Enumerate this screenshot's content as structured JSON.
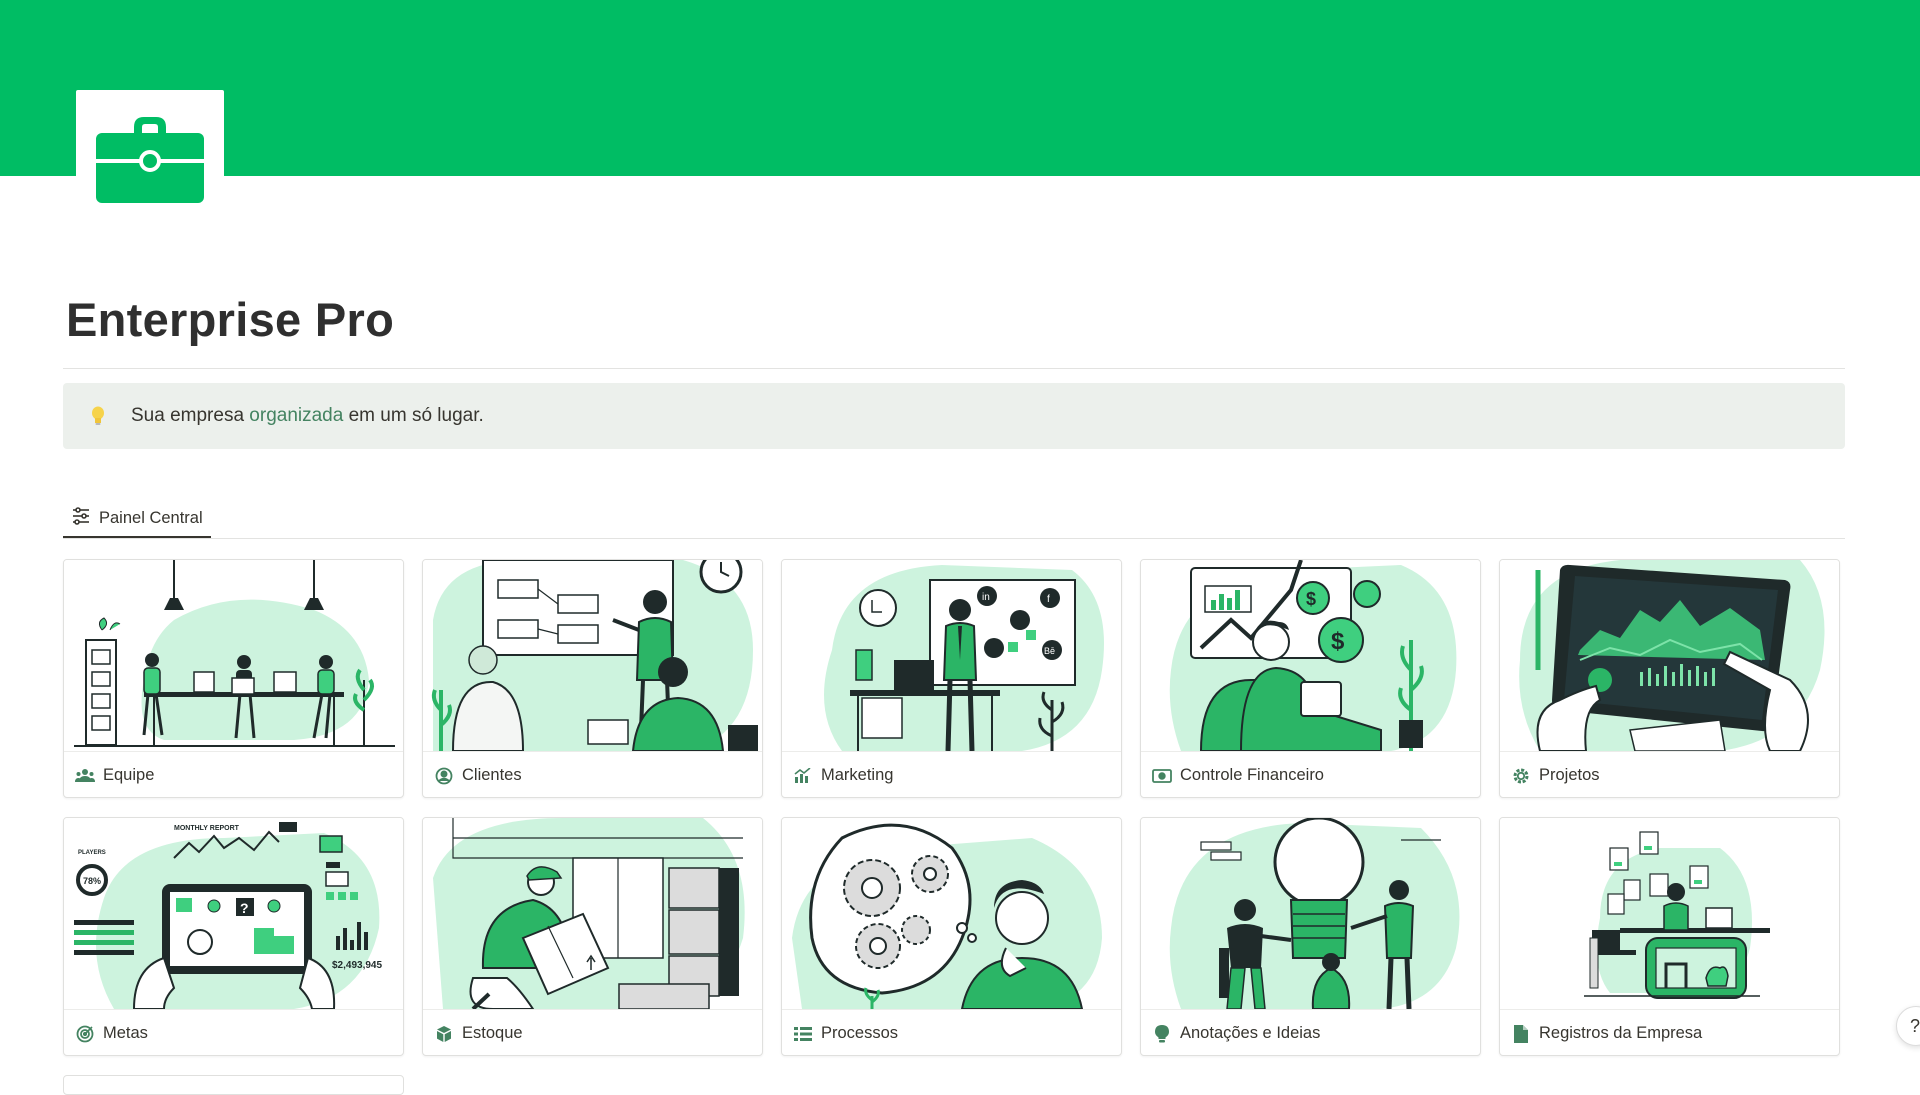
{
  "page": {
    "title": "Enterprise Pro",
    "cover_color": "#00bd64",
    "page_icon": "briefcase-icon"
  },
  "callout": {
    "icon": "lightbulb-icon",
    "text_before": "Sua empresa ",
    "text_highlight": "organizada",
    "text_after": " em um só lugar."
  },
  "view_tab": {
    "icon": "sliders-icon",
    "label": "Painel Central"
  },
  "cards": [
    {
      "title": "Equipe",
      "icon": "team-icon",
      "illustration": "office-team"
    },
    {
      "title": "Clientes",
      "icon": "user-circle-icon",
      "illustration": "client-presentation"
    },
    {
      "title": "Marketing",
      "icon": "chart-icon",
      "illustration": "social-media-board"
    },
    {
      "title": "Controle Financeiro",
      "icon": "money-icon",
      "illustration": "finance-growth"
    },
    {
      "title": "Projetos",
      "icon": "gear-icon",
      "illustration": "tablet-analytics"
    },
    {
      "title": "Metas",
      "icon": "target-icon",
      "illustration": "monthly-report"
    },
    {
      "title": "Estoque",
      "icon": "box-icon",
      "illustration": "warehouse-delivery"
    },
    {
      "title": "Processos",
      "icon": "list-icon",
      "illustration": "thinking-gears"
    },
    {
      "title": "Anotações e Ideias",
      "icon": "lightbulb-small-icon",
      "illustration": "big-idea"
    },
    {
      "title": "Registros da Empresa",
      "icon": "document-icon",
      "illustration": "records-desk"
    }
  ],
  "illustration_text": {
    "monthly_report": "MONTHLY REPORT",
    "players": "PLAYERS",
    "percent": "78%",
    "amount": "$2,493,945"
  },
  "help_button": {
    "label": "?"
  },
  "colors": {
    "accent": "#00bd64",
    "callout_bg": "#ecf0ec",
    "highlight_text": "#448361"
  }
}
